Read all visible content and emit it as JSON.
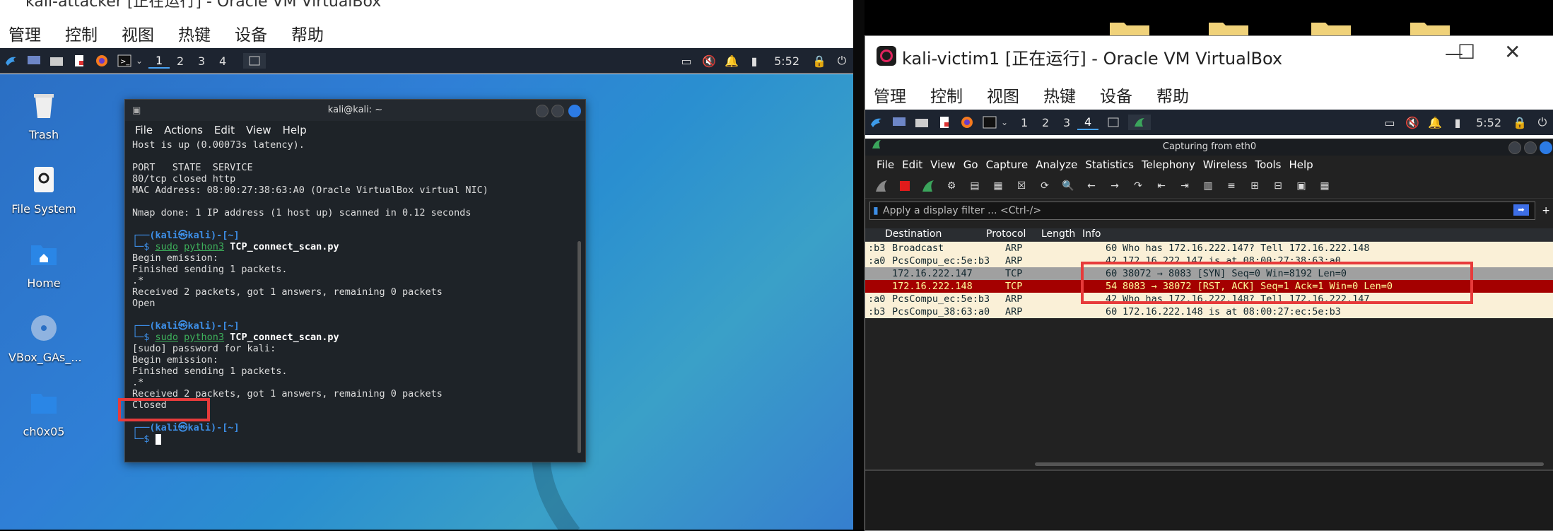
{
  "left_window": {
    "title": "kali-attacker [正在运行] - Oracle VM VirtualBox",
    "menu": [
      "管理",
      "控制",
      "视图",
      "热键",
      "设备",
      "帮助"
    ],
    "workspaces": [
      "1",
      "2",
      "3",
      "4"
    ],
    "clock": "5:52",
    "desktop_icons": [
      "Trash",
      "File System",
      "Home",
      "VBox_GAs_...",
      "ch0x05"
    ],
    "terminal": {
      "title": "kali@kali: ~",
      "menu": [
        "File",
        "Actions",
        "Edit",
        "View",
        "Help"
      ],
      "lines": [
        "Host is up (0.00073s latency).",
        "",
        "PORT   STATE  SERVICE",
        "80/tcp closed http",
        "MAC Address: 08:00:27:38:63:A0 (Oracle VirtualBox virtual NIC)",
        "",
        "Nmap done: 1 IP address (1 host up) scanned in 0.12 seconds",
        ""
      ],
      "prompt_user": "(kali㉿kali)-[~]",
      "cmd1_sudo": "sudo",
      "cmd1_py": "python3",
      "cmd1_file": "TCP_connect_scan.py",
      "block1": [
        "Begin emission:",
        "Finished sending 1 packets.",
        ".*",
        "Received 2 packets, got 1 answers, remaining 0 packets",
        "Open"
      ],
      "cmd2_file": "TCP_connect_scan.py",
      "block2": [
        "[sudo] password for kali:",
        "Begin emission:",
        "Finished sending 1 packets.",
        ".*",
        "Received 2 packets, got 1 answers, remaining 0 packets",
        "Closed"
      ],
      "prompt_end": "$"
    }
  },
  "right_window": {
    "title": "kali-victim1 [正在运行] - Oracle VM VirtualBox",
    "menu": [
      "管理",
      "控制",
      "视图",
      "热键",
      "设备",
      "帮助"
    ],
    "workspaces": [
      "1",
      "2",
      "3",
      "4"
    ],
    "clock": "5:52",
    "wireshark": {
      "title": "Capturing from eth0",
      "menu": [
        "File",
        "Edit",
        "View",
        "Go",
        "Capture",
        "Analyze",
        "Statistics",
        "Telephony",
        "Wireless",
        "Tools",
        "Help"
      ],
      "filter_placeholder": "Apply a display filter ... <Ctrl-/>",
      "columns": [
        "Destination",
        "Protocol",
        "Length",
        "Info"
      ],
      "packets": [
        {
          "src": ":b3",
          "dst": "Broadcast",
          "proto": "ARP",
          "len": "60",
          "info": "Who has 172.16.222.147? Tell 172.16.222.148"
        },
        {
          "src": ":a0",
          "dst": "PcsCompu_ec:5e:b3",
          "proto": "ARP",
          "len": "42",
          "info": "172.16.222.147 is at 08:00:27:38:63:a0"
        },
        {
          "src": "",
          "dst": "172.16.222.147",
          "proto": "TCP",
          "len": "60",
          "info": "38072 → 8083 [SYN] Seq=0 Win=8192 Len=0"
        },
        {
          "src": "",
          "dst": "172.16.222.148",
          "proto": "TCP",
          "len": "54",
          "info": "8083 → 38072 [RST, ACK] Seq=1 Ack=1 Win=0 Len=0"
        },
        {
          "src": ":a0",
          "dst": "PcsCompu_ec:5e:b3",
          "proto": "ARP",
          "len": "42",
          "info": "Who has 172.16.222.148? Tell 172.16.222.147"
        },
        {
          "src": ":b3",
          "dst": "PcsCompu_38:63:a0",
          "proto": "ARP",
          "len": "60",
          "info": "172.16.222.148 is at 08:00:27:ec:5e:b3"
        }
      ]
    }
  },
  "colors": {
    "highlight_box": "#e73b3b",
    "arp_row": "#faf0d7",
    "tcp_row": "#a0a0a0",
    "selected_row": "#a40000"
  }
}
